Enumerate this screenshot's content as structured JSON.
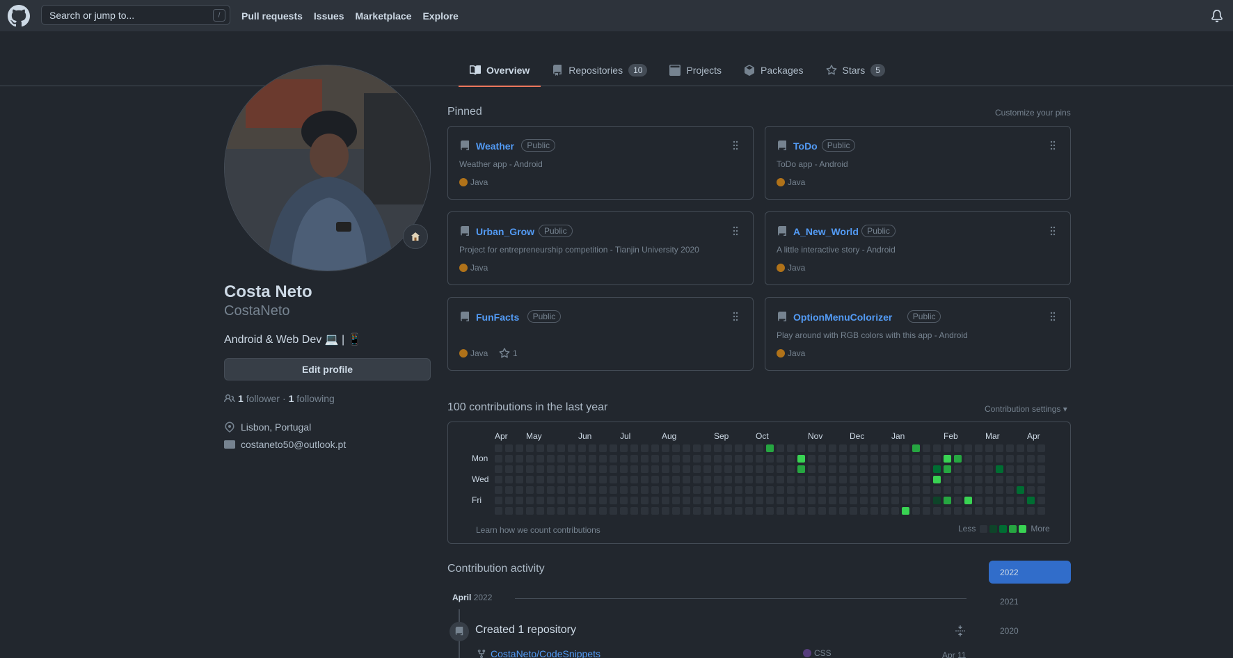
{
  "header": {
    "search_placeholder": "Search or jump to...",
    "search_shortcut": "/",
    "nav": [
      "Pull requests",
      "Issues",
      "Marketplace",
      "Explore"
    ]
  },
  "tabs": [
    {
      "label": "Overview",
      "icon": "book-icon",
      "active": true
    },
    {
      "label": "Repositories",
      "icon": "repo-icon",
      "count": "10"
    },
    {
      "label": "Projects",
      "icon": "project-icon"
    },
    {
      "label": "Packages",
      "icon": "package-icon"
    },
    {
      "label": "Stars",
      "icon": "star-icon",
      "count": "5"
    }
  ],
  "profile": {
    "status_emoji": "house-icon",
    "fullname": "Costa Neto",
    "username": "CostaNeto",
    "bio": "Android & Web Dev 💻 | 📱",
    "edit_label": "Edit profile",
    "followers_count": "1",
    "followers_label": "follower",
    "separator": "·",
    "following_count": "1",
    "following_label": "following",
    "location": "Lisbon, Portugal",
    "email": "costaneto50@outlook.pt"
  },
  "pinned": {
    "title": "Pinned",
    "customize": "Customize your pins",
    "repos": [
      {
        "name": "Weather",
        "visibility": "Public",
        "desc": "Weather app - Android",
        "lang": "Java"
      },
      {
        "name": "ToDo",
        "visibility": "Public",
        "desc": "ToDo app - Android",
        "lang": "Java"
      },
      {
        "name": "Urban_Grow",
        "visibility": "Public",
        "desc": "Project for entrepreneurship competition - Tianjin University 2020",
        "lang": "Java"
      },
      {
        "name": "A_New_World",
        "visibility": "Public",
        "desc": "A little interactive story - Android",
        "lang": "Java"
      },
      {
        "name": "FunFacts",
        "visibility": "Public",
        "desc": "",
        "lang": "Java",
        "stars": "1"
      },
      {
        "name": "OptionMenuColorizer",
        "visibility": "Public",
        "desc": "Play around with RGB colors with this app - Android",
        "lang": "Java"
      }
    ]
  },
  "contributions": {
    "title": "100 contributions in the last year",
    "settings": "Contribution settings ▾",
    "months": [
      "Apr",
      "May",
      "Jun",
      "Jul",
      "Aug",
      "Sep",
      "Oct",
      "Nov",
      "Dec",
      "Jan",
      "Feb",
      "Mar",
      "Apr"
    ],
    "days": [
      "Mon",
      "Wed",
      "Fri"
    ],
    "learn": "Learn how we count contributions",
    "less": "Less",
    "more": "More",
    "levels": [
      "#2d333b",
      "#0e4429",
      "#006d32",
      "#26a641",
      "#39d353"
    ],
    "active_cells": [
      {
        "week": 26,
        "day": 0,
        "level": 3
      },
      {
        "week": 29,
        "day": 1,
        "level": 4
      },
      {
        "week": 29,
        "day": 2,
        "level": 3
      },
      {
        "week": 39,
        "day": 6,
        "level": 4
      },
      {
        "week": 40,
        "day": 0,
        "level": 3
      },
      {
        "week": 42,
        "day": 2,
        "level": 2
      },
      {
        "week": 42,
        "day": 3,
        "level": 4
      },
      {
        "week": 42,
        "day": 5,
        "level": 1
      },
      {
        "week": 43,
        "day": 1,
        "level": 4
      },
      {
        "week": 43,
        "day": 2,
        "level": 3
      },
      {
        "week": 43,
        "day": 5,
        "level": 3
      },
      {
        "week": 44,
        "day": 1,
        "level": 3
      },
      {
        "week": 45,
        "day": 5,
        "level": 4
      },
      {
        "week": 48,
        "day": 2,
        "level": 2
      },
      {
        "week": 50,
        "day": 4,
        "level": 2
      },
      {
        "week": 51,
        "day": 5,
        "level": 2
      },
      {
        "week": 56,
        "day": 1,
        "level": 1
      }
    ]
  },
  "activity": {
    "title": "Contribution activity",
    "years": [
      "2022",
      "2021",
      "2020"
    ],
    "month": "April",
    "month_year": "2022",
    "event_title": "Created 1 repository",
    "repo": "CostaNeto/CodeSnippets",
    "repo_lang": "CSS",
    "repo_date": "Apr 11"
  },
  "colors": {
    "java": "#b07219",
    "css": "#563d7c",
    "accent": "#539bf5",
    "tab_underline": "#ec775c"
  }
}
